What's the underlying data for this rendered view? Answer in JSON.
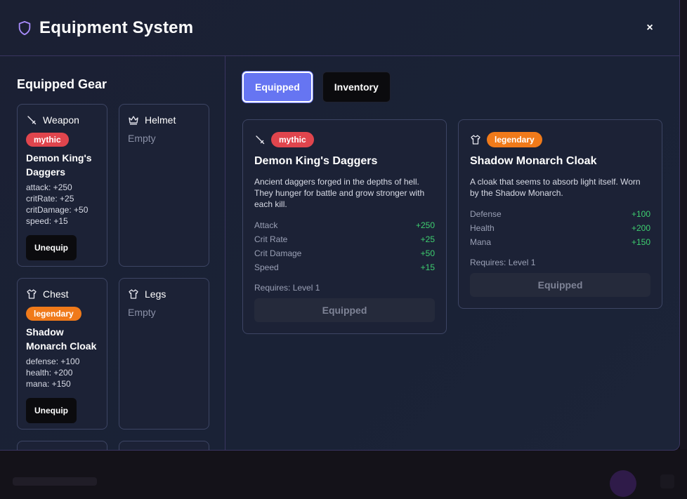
{
  "header": {
    "title": "Equipment System",
    "close_label": "×"
  },
  "left": {
    "section_title": "Equipped Gear",
    "slots": [
      {
        "name": "Weapon",
        "icon": "sword-icon",
        "rarity": "mythic",
        "item_name": "Demon King's Daggers",
        "stats": [
          "attack: +250",
          "critRate: +25",
          "critDamage: +50",
          "speed: +15"
        ],
        "button": "Unequip"
      },
      {
        "name": "Helmet",
        "icon": "crown-icon",
        "empty": "Empty"
      },
      {
        "name": "Chest",
        "icon": "shirt-icon",
        "rarity": "legendary",
        "item_name": "Shadow Monarch Cloak",
        "stats": [
          "defense: +100",
          "health: +200",
          "mana: +150"
        ],
        "button": "Unequip"
      },
      {
        "name": "Legs",
        "icon": "shirt-icon",
        "empty": "Empty"
      }
    ]
  },
  "tabs": [
    {
      "label": "Equipped",
      "active": true
    },
    {
      "label": "Inventory",
      "active": false
    }
  ],
  "cards": [
    {
      "icon": "sword-icon",
      "rarity": "mythic",
      "title": "Demon King's Daggers",
      "description": "Ancient daggers forged in the depths of hell. They hunger for battle and grow stronger with each kill.",
      "stats": [
        {
          "label": "Attack",
          "value": "+250"
        },
        {
          "label": "Crit Rate",
          "value": "+25"
        },
        {
          "label": "Crit Damage",
          "value": "+50"
        },
        {
          "label": "Speed",
          "value": "+15"
        }
      ],
      "requirement": "Requires: Level 1",
      "button": "Equipped"
    },
    {
      "icon": "shirt-icon",
      "rarity": "legendary",
      "title": "Shadow Monarch Cloak",
      "description": "A cloak that seems to absorb light itself. Worn by the Shadow Monarch.",
      "stats": [
        {
          "label": "Defense",
          "value": "+100"
        },
        {
          "label": "Health",
          "value": "+200"
        },
        {
          "label": "Mana",
          "value": "+150"
        }
      ],
      "requirement": "Requires: Level 1",
      "button": "Equipped"
    }
  ],
  "colors": {
    "accent": "#6675f2",
    "mythic": "#e0454d",
    "legendary": "#f07a1a",
    "stat_positive": "#3ecf70",
    "shield": "#a78bfa"
  }
}
